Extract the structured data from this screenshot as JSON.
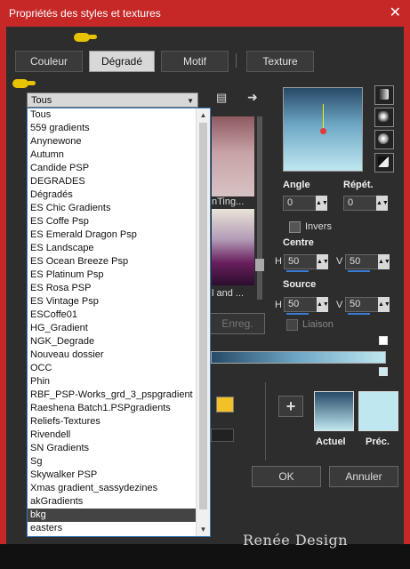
{
  "window": {
    "title": "Propriétés des styles et textures",
    "close_glyph": "✕"
  },
  "tabs": [
    {
      "label": "Couleur",
      "active": false
    },
    {
      "label": "Dégradé",
      "active": true
    },
    {
      "label": "Motif",
      "active": false
    },
    {
      "label": "Texture",
      "active": false
    }
  ],
  "category": {
    "selected": "Tous",
    "arrow": "▼"
  },
  "list": {
    "items": [
      "Tous",
      "559 gradients",
      "Anynewone",
      "Autumn",
      "Candide PSP",
      "DEGRADES",
      "Dégradés",
      "ES Chic Gradients",
      "ES Coffe Psp",
      "ES Emerald Dragon Psp",
      "ES Landscape",
      "ES Ocean Breeze Psp",
      "ES Platinum Psp",
      "ES Rosa PSP",
      "ES Vintage Psp",
      "ESCoffe01",
      "HG_Gradient",
      "NGK_Degrade",
      "Nouveau dossier",
      "OCC",
      "Phin",
      "RBF_PSP-Works_grd_3_pspgradient",
      "Raeshena Batch1.PSPgradients",
      "Reliefs-Textures",
      "Rivendell",
      "SN Gradients",
      "Sg",
      "Skywalker PSP",
      "Xmas gradient_sassydezines",
      "akGradients",
      "bkg",
      "easters"
    ],
    "highlighted": "bkg",
    "scroll_up": "▲",
    "scroll_down": "▼"
  },
  "swatches": {
    "label1": "nTing...",
    "label2": "l and ..."
  },
  "save_button": "Enreg.",
  "angle": {
    "label": "Angle",
    "value": "0"
  },
  "repeat": {
    "label": "Répét.",
    "value": "0"
  },
  "invert": {
    "label": "Invers"
  },
  "centre": {
    "label": "Centre",
    "h_label": "H",
    "h_value": "50",
    "v_label": "V",
    "v_value": "50"
  },
  "source": {
    "label": "Source",
    "h_label": "H",
    "h_value": "50",
    "v_label": "V",
    "v_value": "50"
  },
  "link": {
    "label": "Liaison"
  },
  "add_glyph": "+",
  "current": {
    "label": "Actuel"
  },
  "previous": {
    "label": "Préc."
  },
  "ok_label": "OK",
  "cancel_label": "Annuler",
  "signature": "Renée Design",
  "colors": {
    "title_bar": "#c62828",
    "client": "#2d2d2d",
    "gradient_dark": "#274a67",
    "gradient_light": "#bfe7f0",
    "highlight_row": "#444444",
    "swatch_gold": "#f2c027"
  }
}
